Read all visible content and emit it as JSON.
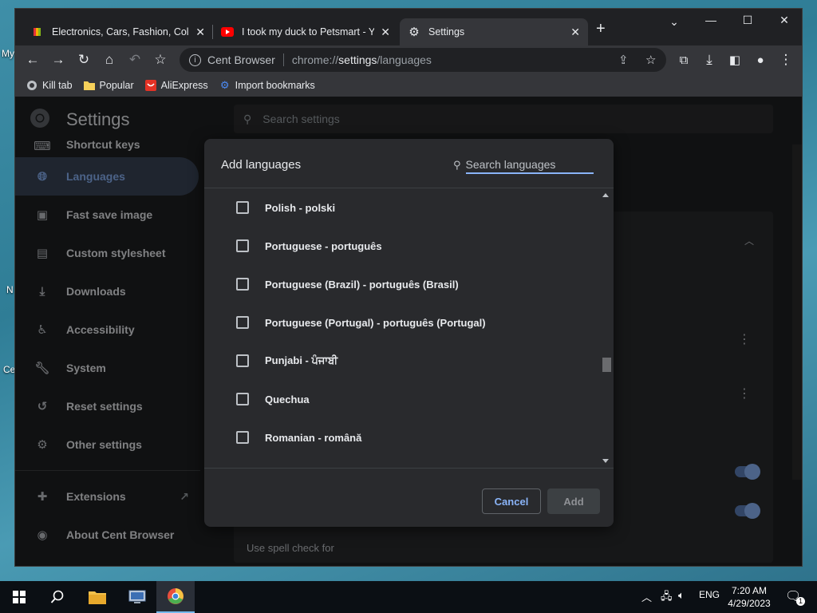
{
  "desktop": {
    "labels": [
      "My",
      "N",
      "Ce"
    ]
  },
  "browser": {
    "tabs": [
      {
        "title": "Electronics, Cars, Fashion, Collect",
        "icon": "ebay-icon"
      },
      {
        "title": "I took my duck to Petsmart - You",
        "icon": "youtube-icon"
      },
      {
        "title": "Settings",
        "icon": "gear-icon"
      }
    ],
    "omnibox": {
      "site": "Cent Browser",
      "url_prefix": "chrome://",
      "url_host": "settings",
      "url_path": "/languages"
    },
    "bookmarks": [
      {
        "label": "Kill tab",
        "icon": "kill-tab-icon"
      },
      {
        "label": "Popular",
        "icon": "folder-icon"
      },
      {
        "label": "AliExpress",
        "icon": "aliexpress-icon"
      },
      {
        "label": "Import bookmarks",
        "icon": "import-icon"
      }
    ]
  },
  "settings": {
    "title": "Settings",
    "search_placeholder": "Search settings",
    "nav": [
      {
        "label": "Shortcut keys",
        "icon": "keyboard-icon"
      },
      {
        "label": "Languages",
        "icon": "globe-icon",
        "active": true
      },
      {
        "label": "Fast save image",
        "icon": "image-icon"
      },
      {
        "label": "Custom stylesheet",
        "icon": "stylesheet-icon"
      },
      {
        "label": "Downloads",
        "icon": "download-icon"
      },
      {
        "label": "Accessibility",
        "icon": "accessibility-icon"
      },
      {
        "label": "System",
        "icon": "wrench-icon"
      },
      {
        "label": "Reset settings",
        "icon": "reset-icon"
      },
      {
        "label": "Other settings",
        "icon": "gear-icon"
      }
    ],
    "extensions_label": "Extensions",
    "about_label": "About Cent Browser",
    "spell_check_label": "Use spell check for"
  },
  "dialog": {
    "title": "Add languages",
    "search_placeholder": "Search languages",
    "languages": [
      "Polish - polski",
      "Portuguese - português",
      "Portuguese (Brazil) - português (Brasil)",
      "Portuguese (Portugal) - português (Portugal)",
      "Punjabi - ਪੰਜਾਬੀ",
      "Quechua",
      "Romanian - română"
    ],
    "cancel_label": "Cancel",
    "add_label": "Add"
  },
  "taskbar": {
    "language": "ENG",
    "time": "7:20 AM",
    "date": "4/29/2023",
    "notifications": "1"
  },
  "colors": {
    "accent": "#8ab4f8",
    "active_nav_bg": "#394457",
    "dialog_bg": "#292a2d"
  }
}
